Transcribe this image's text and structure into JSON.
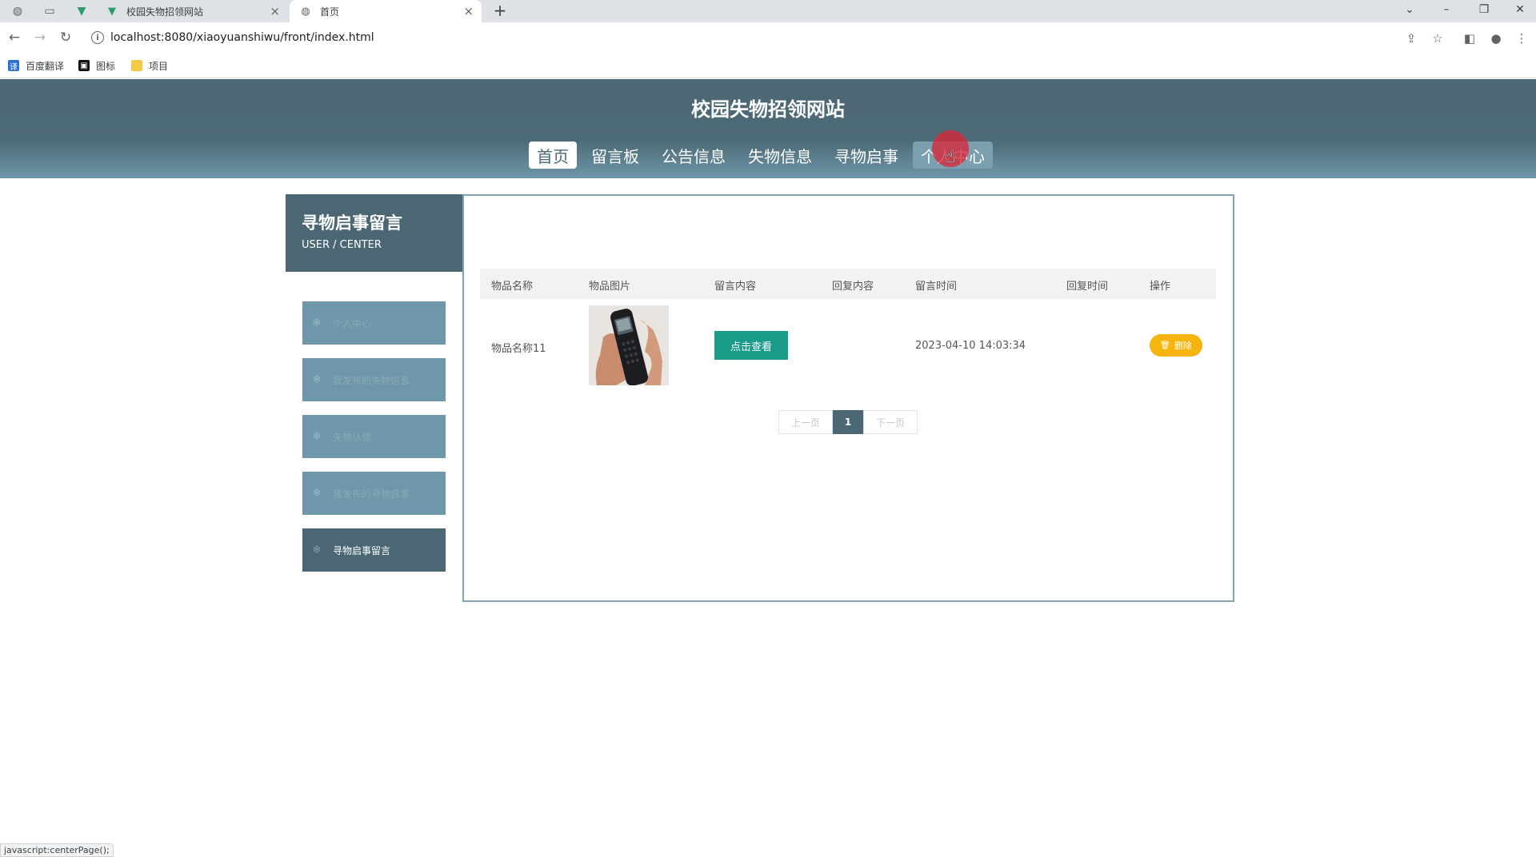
{
  "browser": {
    "tabs": [
      {
        "title": "校园失物招领网站",
        "active": false
      },
      {
        "title": "首页",
        "active": true
      }
    ],
    "url": "localhost:8080/xiaoyuanshiwu/front/index.html",
    "bookmarks": [
      "百度翻译",
      "图标",
      "项目"
    ],
    "status_text": "javascript:centerPage();"
  },
  "site": {
    "title": "校园失物招领网站",
    "nav": [
      "首页",
      "留言板",
      "公告信息",
      "失物信息",
      "寻物启事",
      "个人中心"
    ],
    "active_nav": "首页"
  },
  "sidebar": {
    "title": "寻物启事留言",
    "subtitle": "USER / CENTER",
    "items": [
      "个人中心",
      "我发布的失物信息",
      "失物认领",
      "我发布的寻物启事",
      "寻物启事留言"
    ],
    "active_item": "寻物启事留言"
  },
  "table": {
    "headers": [
      "物品名称",
      "物品图片",
      "留言内容",
      "回复内容",
      "留言时间",
      "回复时间",
      "操作"
    ],
    "rows": [
      {
        "name": "物品名称11",
        "image": "phone-photo",
        "content_button": "点击查看",
        "reply": "",
        "time": "2023-04-10 14:03:34",
        "reply_time": "",
        "delete_label": "删除"
      }
    ]
  },
  "pager": {
    "prev": "上一页",
    "current": "1",
    "next": "下一页"
  },
  "colors": {
    "primary": "#4b6773",
    "menu": "#6e97aa",
    "teal_button": "#1a9c8b",
    "delete_button": "#f5b50e",
    "cursor": "#d62839"
  }
}
